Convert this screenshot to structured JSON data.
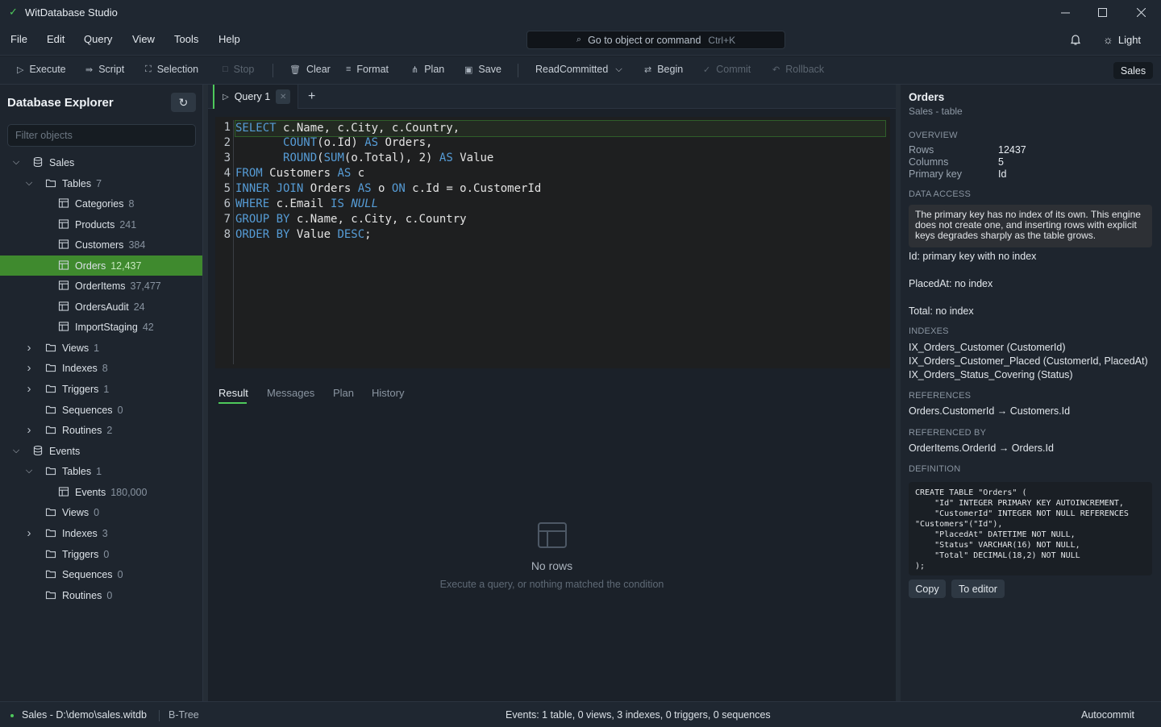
{
  "app": {
    "title": "WitDatabase Studio"
  },
  "menu": [
    "File",
    "Edit",
    "Query",
    "View",
    "Tools",
    "Help"
  ],
  "command_search": {
    "label": "Go to object or command",
    "shortcut": "Ctrl+K"
  },
  "theme_toggle": "Light",
  "toolbar": {
    "execute": "Execute",
    "script": "Script",
    "selection": "Selection",
    "stop": "Stop",
    "clear": "Clear",
    "format": "Format",
    "plan": "Plan",
    "save": "Save",
    "isolation": "ReadCommitted",
    "begin": "Begin",
    "commit": "Commit",
    "rollback": "Rollback",
    "database": "Sales"
  },
  "explorer": {
    "title": "Database Explorer",
    "filter_placeholder": "Filter objects",
    "nodes": [
      {
        "label": "Sales",
        "count": ""
      },
      {
        "label": "Tables",
        "count": "7"
      },
      {
        "label": "Categories",
        "count": "8"
      },
      {
        "label": "Products",
        "count": "241"
      },
      {
        "label": "Customers",
        "count": "384"
      },
      {
        "label": "Orders",
        "count": "12,437"
      },
      {
        "label": "OrderItems",
        "count": "37,477"
      },
      {
        "label": "OrdersAudit",
        "count": "24"
      },
      {
        "label": "ImportStaging",
        "count": "42"
      },
      {
        "label": "Views",
        "count": "1"
      },
      {
        "label": "Indexes",
        "count": "8"
      },
      {
        "label": "Triggers",
        "count": "1"
      },
      {
        "label": "Sequences",
        "count": "0"
      },
      {
        "label": "Routines",
        "count": "2"
      },
      {
        "label": "Events",
        "count": ""
      },
      {
        "label": "Tables",
        "count": "1"
      },
      {
        "label": "Events",
        "count": "180,000"
      },
      {
        "label": "Views",
        "count": "0"
      },
      {
        "label": "Indexes",
        "count": "3"
      },
      {
        "label": "Triggers",
        "count": "0"
      },
      {
        "label": "Sequences",
        "count": "0"
      },
      {
        "label": "Routines",
        "count": "0"
      }
    ]
  },
  "editor": {
    "tab_label": "Query 1",
    "lines": [
      "1",
      "2",
      "3",
      "4",
      "5",
      "6",
      "7",
      "8"
    ]
  },
  "result": {
    "tabs": [
      "Result",
      "Messages",
      "Plan",
      "History"
    ],
    "empty_title": "No rows",
    "empty_subtitle": "Execute a query, or nothing matched the condition"
  },
  "properties": {
    "title": "Orders",
    "subtitle": "Sales - table",
    "overview_heading": "OVERVIEW",
    "rows_label": "Rows",
    "rows_value": "12437",
    "columns_label": "Columns",
    "columns_value": "5",
    "pk_label": "Primary key",
    "pk_value": "Id",
    "data_access_heading": "DATA ACCESS",
    "data_access_note": "The primary key has no index of its own. This engine does not create one, and inserting rows with explicit keys degrades sharply as the table grows.",
    "issues": [
      "Id: primary key with no index",
      "PlacedAt: no index",
      "Total: no index"
    ],
    "indexes_heading": "INDEXES",
    "indexes": [
      "IX_Orders_Customer (CustomerId)",
      "IX_Orders_Customer_Placed (CustomerId, PlacedAt)",
      "IX_Orders_Status_Covering (Status)"
    ],
    "references_heading": "REFERENCES",
    "references": "Orders.CustomerId → Customers.Id",
    "referenced_by_heading": "REFERENCED BY",
    "referenced_by": "OrderItems.OrderId → Orders.Id",
    "definition_heading": "DEFINITION",
    "definition": "CREATE TABLE \"Orders\" (\n    \"Id\" INTEGER PRIMARY KEY AUTOINCREMENT,\n    \"CustomerId\" INTEGER NOT NULL REFERENCES\n\"Customers\"(\"Id\"),\n    \"PlacedAt\" DATETIME NOT NULL,\n    \"Status\" VARCHAR(16) NOT NULL,\n    \"Total\" DECIMAL(18,2) NOT NULL\n);",
    "copy_button": "Copy",
    "to_editor_button": "To editor"
  },
  "status": {
    "connection": "Sales - D:\\demo\\sales.witdb",
    "engine": "B-Tree",
    "summary": "Events: 1 table, 0 views, 3 indexes, 0 triggers, 0 sequences",
    "mode": "Autocommit"
  },
  "colors": {
    "accent": "#4ec95b",
    "selection": "#3f8a2e",
    "keyword": "#569cd6"
  }
}
